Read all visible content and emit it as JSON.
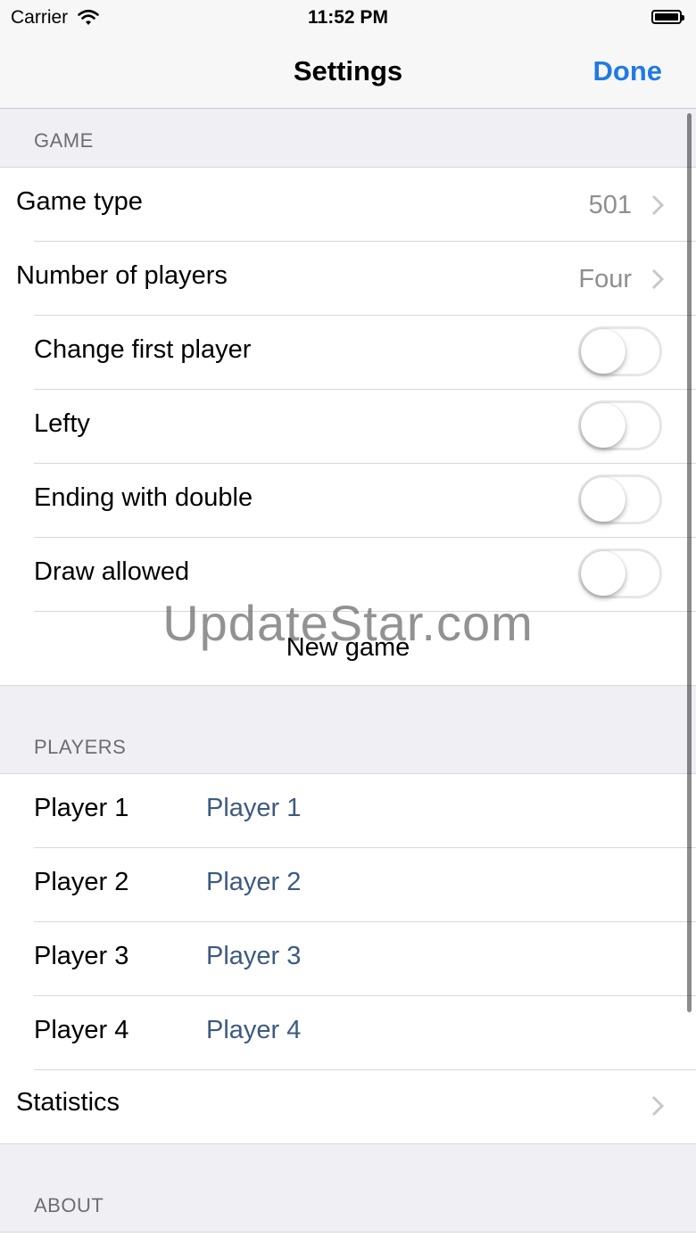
{
  "status_bar": {
    "carrier": "Carrier",
    "time": "11:52 PM"
  },
  "nav": {
    "title": "Settings",
    "done": "Done"
  },
  "sections": {
    "game": {
      "header": "GAME",
      "game_type": {
        "label": "Game type",
        "value": "501"
      },
      "players_count": {
        "label": "Number of players",
        "value": "Four"
      },
      "toggles": [
        {
          "label": "Change first player",
          "on": false
        },
        {
          "label": "Lefty",
          "on": false
        },
        {
          "label": "Ending with double",
          "on": false
        },
        {
          "label": "Draw allowed",
          "on": false
        }
      ],
      "new_game": "New game"
    },
    "players": {
      "header": "PLAYERS",
      "rows": [
        {
          "label": "Player 1",
          "value": "Player 1"
        },
        {
          "label": "Player 2",
          "value": "Player 2"
        },
        {
          "label": "Player 3",
          "value": "Player 3"
        },
        {
          "label": "Player 4",
          "value": "Player 4"
        }
      ],
      "statistics": "Statistics"
    },
    "about": {
      "header": "ABOUT"
    }
  },
  "watermark": "UpdateStar.com",
  "colors": {
    "accent": "#1f7ae5",
    "player_value": "#3d5a80",
    "secondary_text": "#8e8e93",
    "background": "#efeff4"
  },
  "icons": [
    "wifi-icon",
    "battery-icon",
    "chevron-right-icon"
  ]
}
